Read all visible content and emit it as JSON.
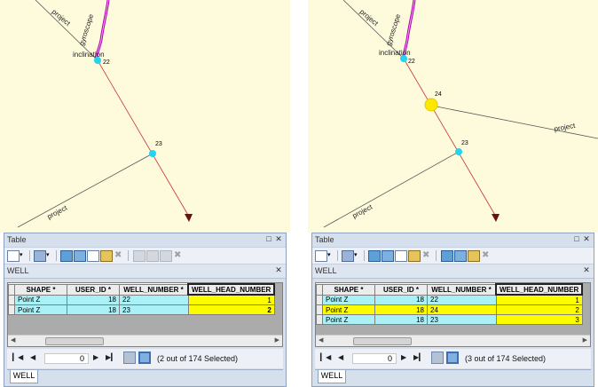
{
  "colors": {
    "map_bg": "#fdfbdc",
    "selected_row": "#fdfb00",
    "cyan_row": "#a9f0f7",
    "trace": "#cc3333"
  },
  "panels": [
    {
      "map": {
        "labels": {
          "project_a": "project",
          "gyroscope": "gyroscope",
          "inclination": "inclination",
          "project_b": "project"
        },
        "points": [
          "22",
          "23"
        ]
      },
      "window": {
        "title": "Table",
        "layer": "WELL",
        "columns": [
          "SHAPE *",
          "USER_ID *",
          "WELL_NUMBER *",
          "WELL_HEAD_NUMBER"
        ],
        "rows": [
          {
            "shape": "Point Z",
            "user_id": "18",
            "well_number": "22",
            "well_head": "1",
            "selected": true
          },
          {
            "shape": "Point Z",
            "user_id": "18",
            "well_number": "23",
            "well_head": "2",
            "selected": true
          }
        ],
        "record": "0",
        "status": "(2 out of 174 Selected)",
        "tab": "WELL"
      }
    },
    {
      "map": {
        "labels": {
          "project_a": "project",
          "gyroscope": "gyroscope",
          "inclination": "inclination",
          "project_b": "project",
          "project_c": "project"
        },
        "points": [
          "22",
          "24",
          "23"
        ]
      },
      "window": {
        "title": "Table",
        "layer": "WELL",
        "columns": [
          "SHAPE *",
          "USER_ID *",
          "WELL_NUMBER *",
          "WELL_HEAD_NUMBER"
        ],
        "rows": [
          {
            "shape": "Point Z",
            "user_id": "18",
            "well_number": "22",
            "well_head": "1",
            "selected": true
          },
          {
            "shape": "Point Z",
            "user_id": "18",
            "well_number": "24",
            "well_head": "2",
            "selected": true
          },
          {
            "shape": "Point Z",
            "user_id": "18",
            "well_number": "23",
            "well_head": "3",
            "selected": true
          }
        ],
        "record": "0",
        "status": "(3 out of 174 Selected)",
        "tab": "WELL"
      }
    }
  ]
}
